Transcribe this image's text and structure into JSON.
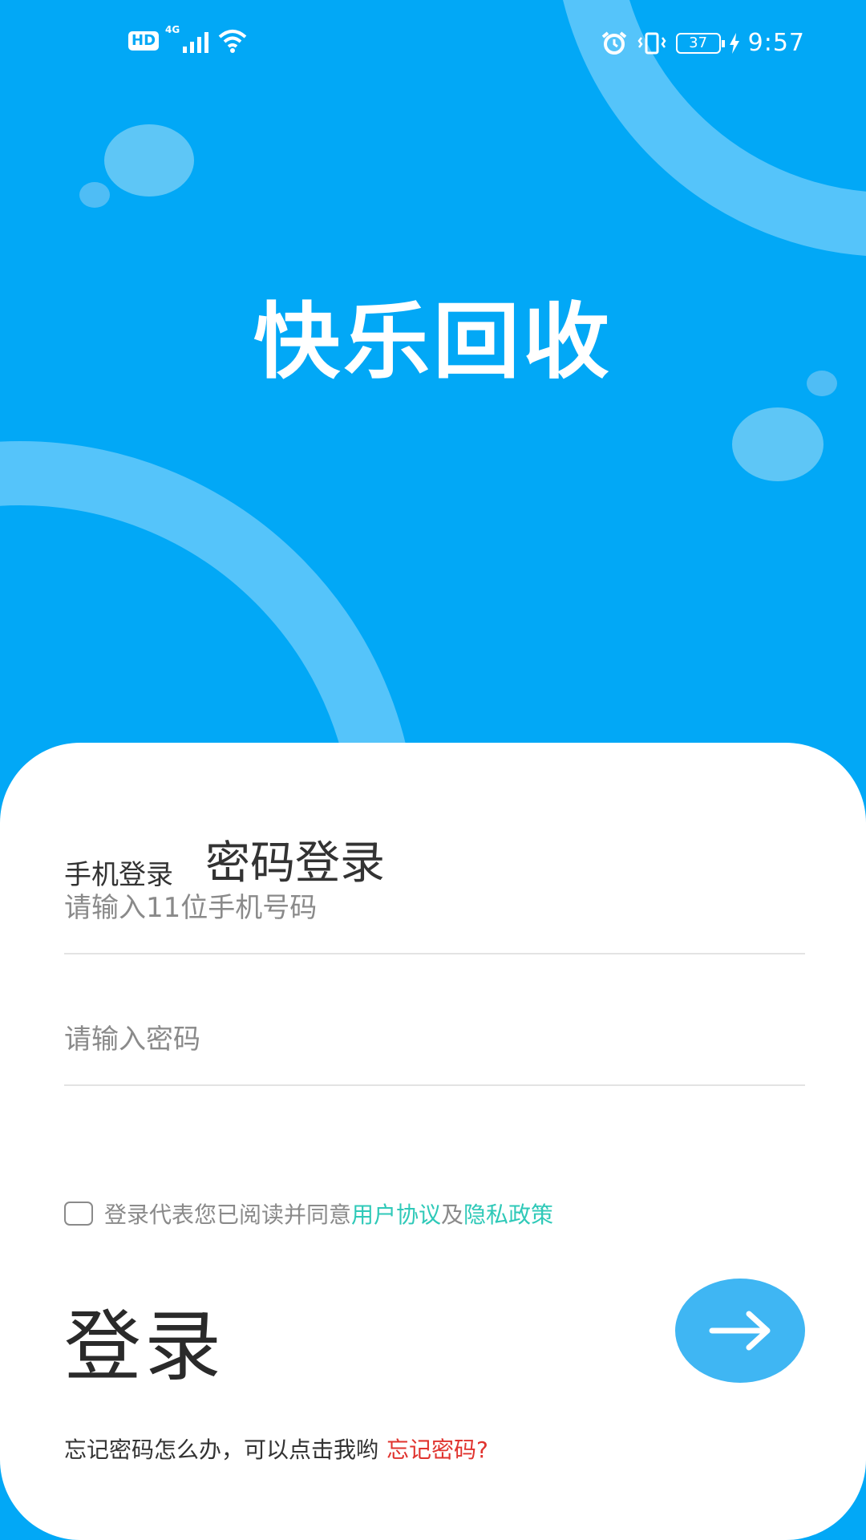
{
  "status_bar": {
    "hd": "HD",
    "network": "4G",
    "battery": "37",
    "time": "9:57"
  },
  "app_title": "快乐回收",
  "login": {
    "tab_phone": "手机登录",
    "tab_password": "密码登录",
    "phone_placeholder": "请输入11位手机号码",
    "password_placeholder": "请输入密码",
    "agree_text": "登录代表您已阅读并同意",
    "user_agreement": "用户协议",
    "and": "及",
    "privacy_policy": "隐私政策",
    "login_label": "登录",
    "forgot_hint": "忘记密码怎么办，可以点击我哟",
    "forgot_link": "忘记密码?"
  },
  "colors": {
    "primary_blue": "#02a8f6",
    "link_green": "#2fc9b8",
    "link_red": "#e0332e"
  }
}
